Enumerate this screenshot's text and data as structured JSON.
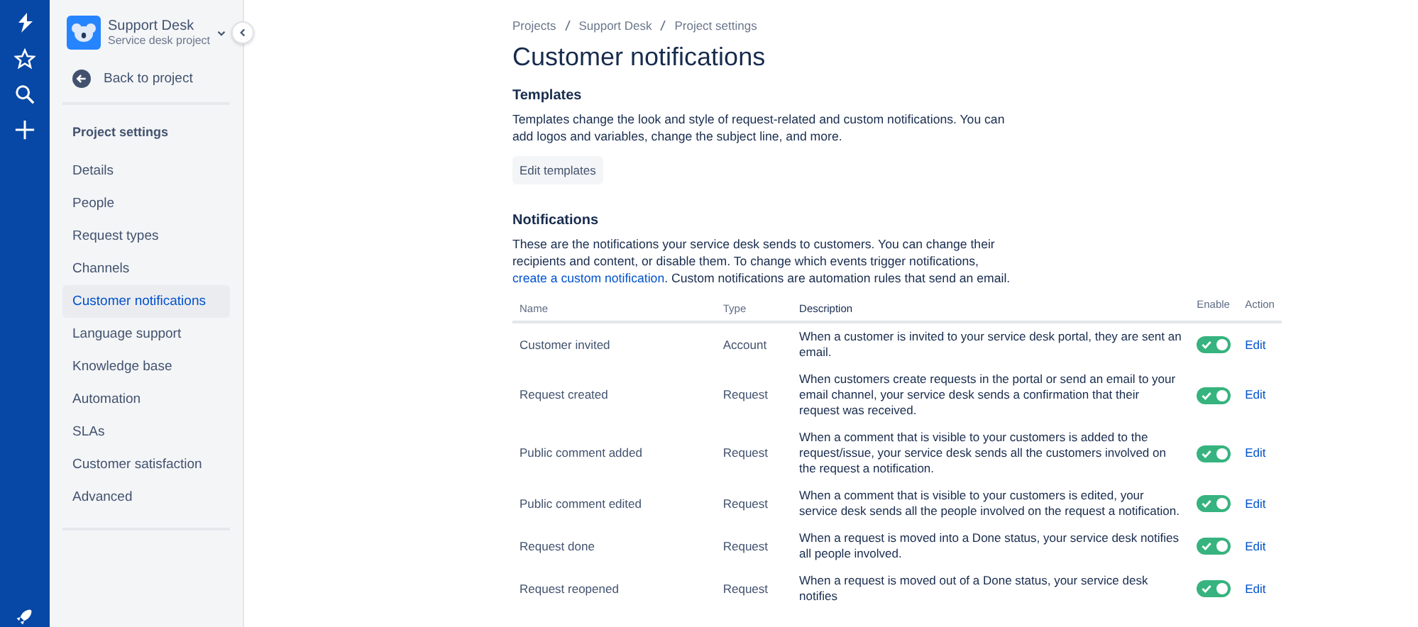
{
  "project": {
    "name": "Support Desk",
    "subtitle": "Service desk project"
  },
  "back_link": "Back to project",
  "sidebar": {
    "heading": "Project settings",
    "items": [
      {
        "label": "Details",
        "selected": false
      },
      {
        "label": "People",
        "selected": false
      },
      {
        "label": "Request types",
        "selected": false
      },
      {
        "label": "Channels",
        "selected": false
      },
      {
        "label": "Customer notifications",
        "selected": true
      },
      {
        "label": "Language support",
        "selected": false
      },
      {
        "label": "Knowledge base",
        "selected": false
      },
      {
        "label": "Automation",
        "selected": false
      },
      {
        "label": "SLAs",
        "selected": false
      },
      {
        "label": "Customer satisfaction",
        "selected": false
      },
      {
        "label": "Advanced",
        "selected": false
      }
    ]
  },
  "breadcrumbs": [
    "Projects",
    "Support Desk",
    "Project settings"
  ],
  "title": "Customer notifications",
  "templates": {
    "heading": "Templates",
    "text": "Templates change the look and style of request-related and custom notifications. You can add logos and variables, change the subject line, and more.",
    "button": "Edit templates"
  },
  "notifications": {
    "heading": "Notifications",
    "text_before": "These are the notifications your service desk sends to customers. You can change their recipients and content, or disable them. To change which events trigger notifications, ",
    "link": "create a custom notification",
    "text_after": ". Custom notifications are automation rules that send an email."
  },
  "table": {
    "columns": [
      "Name",
      "Type",
      "Description",
      "Enable",
      "Action"
    ],
    "rows": [
      {
        "name": "Customer invited",
        "type": "Account",
        "description": "When a customer is invited to your service desk portal, they are sent an email.",
        "enabled": true,
        "action": "Edit"
      },
      {
        "name": "Request created",
        "type": "Request",
        "description": "When customers create requests in the portal or send an email to your email channel, your service desk sends a confirmation that their request was received.",
        "enabled": true,
        "action": "Edit"
      },
      {
        "name": "Public comment added",
        "type": "Request",
        "description": "When a comment that is visible to your customers is added to the request/issue, your service desk sends all the customers involved on the request a notification.",
        "enabled": true,
        "action": "Edit"
      },
      {
        "name": "Public comment edited",
        "type": "Request",
        "description": "When a comment that is visible to your customers is edited, your service desk sends all the people involved on the request a notification.",
        "enabled": true,
        "action": "Edit"
      },
      {
        "name": "Request done",
        "type": "Request",
        "description": "When a request is moved into a Done status, your service desk notifies all people involved.",
        "enabled": true,
        "action": "Edit"
      },
      {
        "name": "Request reopened",
        "type": "Request",
        "description": "When a request is moved out of a Done status, your service desk notifies",
        "enabled": true,
        "action": "Edit"
      }
    ]
  }
}
